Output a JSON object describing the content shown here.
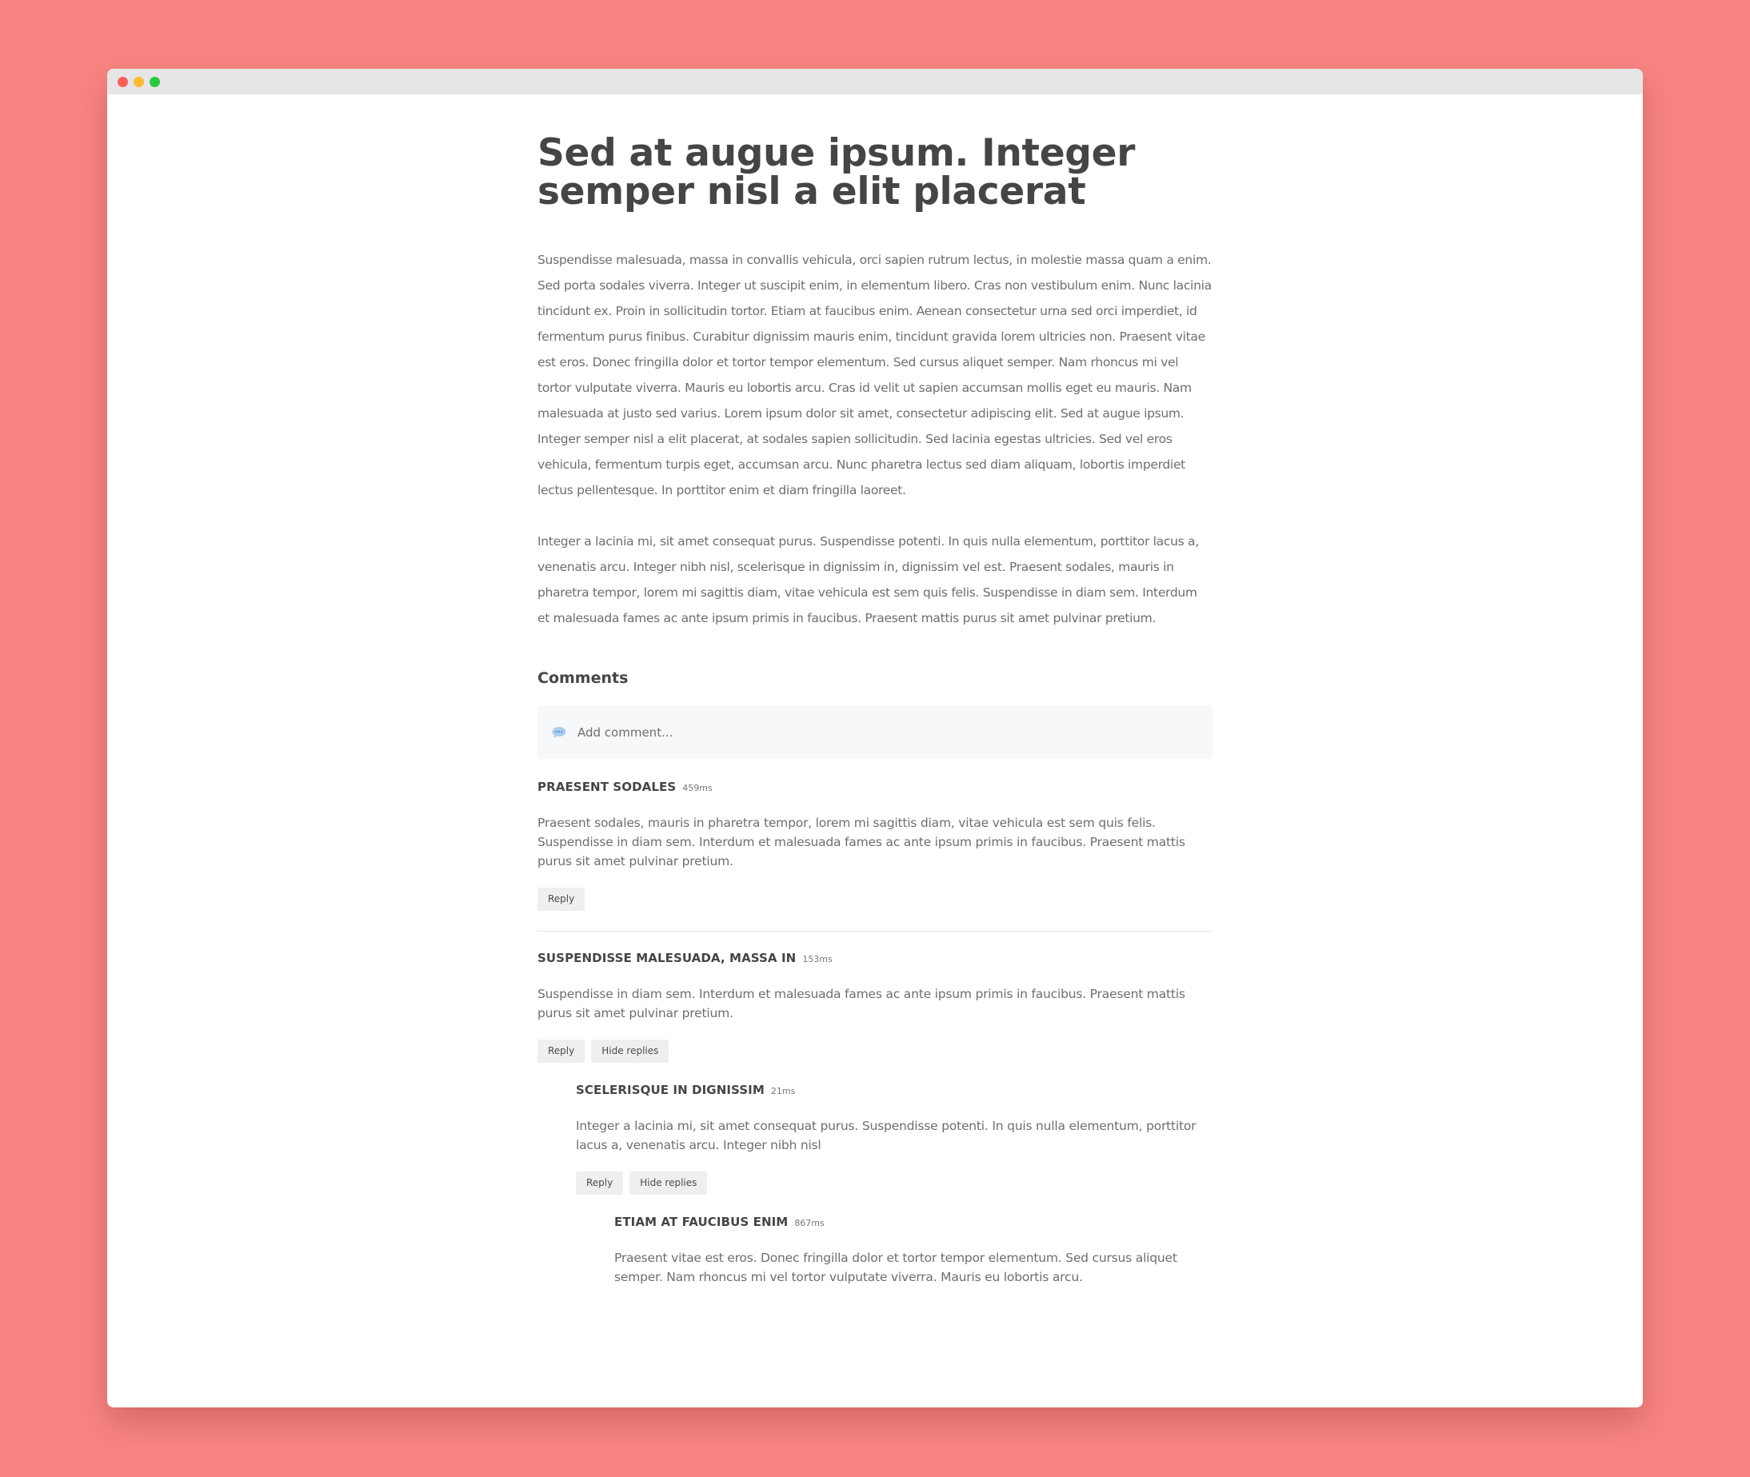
{
  "window": {
    "controls": [
      "close",
      "minimize",
      "maximize"
    ]
  },
  "article": {
    "title": "Sed at augue ipsum. Integer semper nisl a elit placerat",
    "paragraphs": [
      "Suspendisse malesuada, massa in convallis vehicula, orci sapien rutrum lectus, in molestie massa quam a enim. Sed porta sodales viverra. Integer ut suscipit enim, in elementum libero. Cras non vestibulum enim. Nunc lacinia tincidunt ex. Proin in sollicitudin tortor. Etiam at faucibus enim. Aenean consectetur urna sed orci imperdiet, id fermentum purus finibus. Curabitur dignissim mauris enim, tincidunt gravida lorem ultricies non. Praesent vitae est eros. Donec fringilla dolor et tortor tempor elementum. Sed cursus aliquet semper. Nam rhoncus mi vel tortor vulputate viverra. Mauris eu lobortis arcu. Cras id velit ut sapien accumsan mollis eget eu mauris. Nam malesuada at justo sed varius. Lorem ipsum dolor sit amet, consectetur adipiscing elit. Sed at augue ipsum. Integer semper nisl a elit placerat, at sodales sapien sollicitudin. Sed lacinia egestas ultricies. Sed vel eros vehicula, fermentum turpis eget, accumsan arcu. Nunc pharetra lectus sed diam aliquam, lobortis imperdiet lectus pellentesque. In porttitor enim et diam fringilla laoreet.",
      "Integer a lacinia mi, sit amet consequat purus. Suspendisse potenti. In quis nulla elementum, porttitor lacus a, venenatis arcu. Integer nibh nisl, scelerisque in dignissim in, dignissim vel est. Praesent sodales, mauris in pharetra tempor, lorem mi sagittis diam, vitae vehicula est sem quis felis. Suspendisse in diam sem. Interdum et malesuada fames ac ante ipsum primis in faucibus. Praesent mattis purus sit amet pulvinar pretium."
    ]
  },
  "comments": {
    "heading": "Comments",
    "add_placeholder": "Add comment...",
    "add_icon": "speech-bubble-icon",
    "items": [
      {
        "author": "PRAESENT SODALES",
        "time": "459ms",
        "body": "Praesent sodales, mauris in pharetra tempor, lorem mi sagittis diam, vitae vehicula est sem quis felis. Suspendisse in diam sem. Interdum et malesuada fames ac ante ipsum primis in faucibus. Praesent mattis purus sit amet pulvinar pretium.",
        "reply_label": "Reply"
      },
      {
        "author": "SUSPENDISSE MALESUADA, MASSA IN",
        "time": "153ms",
        "body": "Suspendisse in diam sem. Interdum et malesuada fames ac ante ipsum primis in faucibus. Praesent mattis purus sit amet pulvinar pretium.",
        "reply_label": "Reply",
        "hide_label": "Hide replies"
      },
      {
        "author": "SCELERISQUE IN DIGNISSIM",
        "time": "21ms",
        "body": "Integer a lacinia mi, sit amet consequat purus. Suspendisse potenti. In quis nulla elementum, porttitor lacus a, venenatis arcu. Integer nibh nisl",
        "reply_label": "Reply",
        "hide_label": "Hide replies"
      },
      {
        "author": "ETIAM AT FAUCIBUS ENIM",
        "time": "867ms",
        "body": "Praesent vitae est eros. Donec fringilla dolor et tortor tempor elementum. Sed cursus aliquet semper. Nam rhoncus mi vel tortor vulputate viverra. Mauris eu lobortis arcu."
      }
    ]
  },
  "colors": {
    "background": "#f88582",
    "title_text": "#454545",
    "body_text": "#6e6e6e",
    "button_bg": "#efefef",
    "input_bg": "#f6f8fa",
    "icon_blue": "#7fb4e3"
  }
}
